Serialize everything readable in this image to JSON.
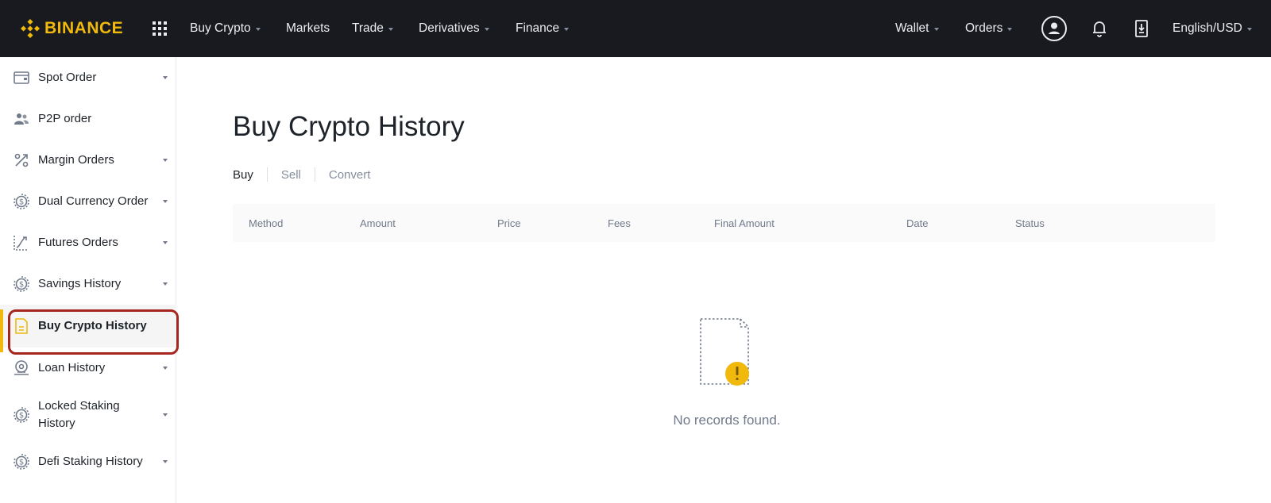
{
  "brand": {
    "name": "BINANCE",
    "color": "#f0b90b"
  },
  "topnav": {
    "left": [
      {
        "label": "Buy Crypto",
        "dropdown": true
      },
      {
        "label": "Markets",
        "dropdown": false
      },
      {
        "label": "Trade",
        "dropdown": true
      },
      {
        "label": "Derivatives",
        "dropdown": true
      },
      {
        "label": "Finance",
        "dropdown": true
      }
    ],
    "wallet_label": "Wallet",
    "orders_label": "Orders",
    "language_label": "English/USD",
    "icons": [
      "apps-grid-icon",
      "user-circle-icon",
      "bell-icon",
      "download-icon"
    ]
  },
  "sidebar": {
    "items": [
      {
        "label": "Spot Order",
        "icon": "wallet-card-icon",
        "dropdown": true
      },
      {
        "label": "P2P order",
        "icon": "users-icon",
        "dropdown": false
      },
      {
        "label": "Margin Orders",
        "icon": "percent-icon",
        "dropdown": true
      },
      {
        "label": "Dual Currency Order",
        "icon": "dollar-coin-icon",
        "dropdown": true
      },
      {
        "label": "Futures Orders",
        "icon": "futures-chart-icon",
        "dropdown": true
      },
      {
        "label": "Savings History",
        "icon": "dollar-coin-icon",
        "dropdown": true
      },
      {
        "label": "Buy Crypto History",
        "icon": "document-icon",
        "dropdown": false,
        "active": true
      },
      {
        "label": "Loan History",
        "icon": "loan-icon",
        "dropdown": true
      },
      {
        "label": "Locked Staking History",
        "icon": "dollar-coin-icon",
        "dropdown": true
      },
      {
        "label": "Defi Staking History",
        "icon": "dollar-coin-icon",
        "dropdown": true
      }
    ],
    "active_color": "#f0b90b",
    "highlight_color": "#a5261f"
  },
  "main": {
    "title": "Buy Crypto History",
    "tabs": [
      {
        "label": "Buy",
        "active": true
      },
      {
        "label": "Sell",
        "active": false
      },
      {
        "label": "Convert",
        "active": false
      }
    ],
    "columns": [
      "Method",
      "Amount",
      "Price",
      "Fees",
      "Final Amount",
      "Date",
      "Status"
    ],
    "rows": [],
    "empty_message": "No records found."
  }
}
